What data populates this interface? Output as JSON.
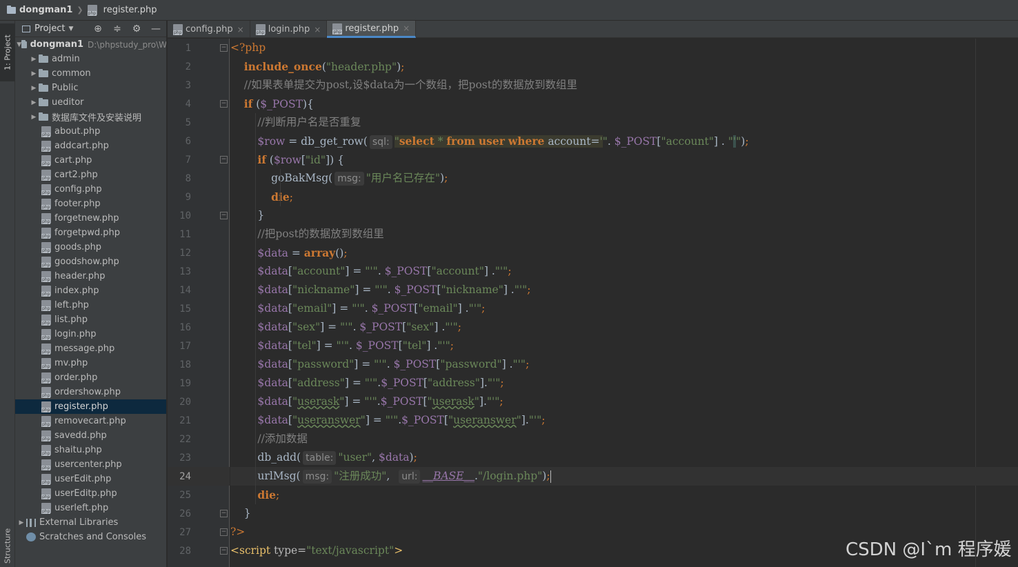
{
  "breadcrumb": {
    "project": "dongman1",
    "file": "register.php"
  },
  "sidebar_tabs": {
    "project": "1: Project",
    "structure": "Structure"
  },
  "project_panel": {
    "title": "Project"
  },
  "tree": {
    "root": {
      "name": "dongman1",
      "path": "D:\\phpstudy_pro\\W"
    },
    "folders": [
      "admin",
      "common",
      "Public",
      "ueditor",
      "数据库文件及安装说明"
    ],
    "files": [
      "about.php",
      "addcart.php",
      "cart.php",
      "cart2.php",
      "config.php",
      "footer.php",
      "forgetnew.php",
      "forgetpwd.php",
      "goods.php",
      "goodshow.php",
      "header.php",
      "index.php",
      "left.php",
      "list.php",
      "login.php",
      "message.php",
      "mv.php",
      "order.php",
      "ordershow.php",
      "register.php",
      "removecart.php",
      "savedd.php",
      "shaitu.php",
      "usercenter.php",
      "userEdit.php",
      "userEditp.php",
      "userleft.php"
    ],
    "selected_file": "register.php",
    "external_libraries": "External Libraries",
    "scratches": "Scratches and Consoles"
  },
  "tabs": [
    {
      "label": "config.php",
      "active": false
    },
    {
      "label": "login.php",
      "active": false
    },
    {
      "label": "register.php",
      "active": true
    }
  ],
  "editor": {
    "current_line": 24,
    "line_numbers": [
      "1",
      "2",
      "3",
      "4",
      "5",
      "6",
      "7",
      "8",
      "9",
      "10",
      "11",
      "12",
      "13",
      "14",
      "15",
      "16",
      "17",
      "18",
      "19",
      "20",
      "21",
      "22",
      "23",
      "24",
      "25",
      "26",
      "27",
      "28"
    ],
    "code": {
      "l1": "<?php",
      "l2_fn": "include_once",
      "l2_arg": "\"header.php\"",
      "l3": "//如果表单提交为post,设$data为一个数组，把post的数据放到数组里",
      "l4_kw": "if",
      "l4_var": "$_POST",
      "l5": "//判断用户名是否重复",
      "l6_var": "$row",
      "l6_fn": "db_get_row",
      "l6_hint": "sql:",
      "l6_sql1": "select",
      "l6_sql2": "from",
      "l6_sql3": "user",
      "l6_sql4": "where",
      "l6_sql5": "account=",
      "l6_post": "$_POST",
      "l6_key": "\"account\"",
      "l7_var": "$row",
      "l7_key": "\"id\"",
      "l8_fn": "goBakMsg",
      "l8_hint": "msg:",
      "l8_str": "\"用户名已存在\"",
      "l9": "die",
      "l11": "//把post的数据放到数组里",
      "l12_var": "$data",
      "l12_fn": "array",
      "l21_key": "useranswer",
      "l22": "//添加数据",
      "l23_fn": "db_add",
      "l23_hint": "table:",
      "l23_str": "\"user\"",
      "l23_var": "$data",
      "l24_fn": "urlMsg",
      "l24_hint1": "msg:",
      "l24_str": "\"注册成功\"",
      "l24_hint2": "url:",
      "l24_const": "__BASE__",
      "l24_path": "\"/login.php\"",
      "l25": "die",
      "l27": "?>",
      "l28_tag": "<script",
      "l28_attr": "type=",
      "l28_val": "\"text/javascript\""
    },
    "data_keys": [
      "account",
      "nickname",
      "email",
      "sex",
      "tel",
      "password",
      "address",
      "userask"
    ]
  },
  "watermark": "CSDN @I`m 程序媛"
}
